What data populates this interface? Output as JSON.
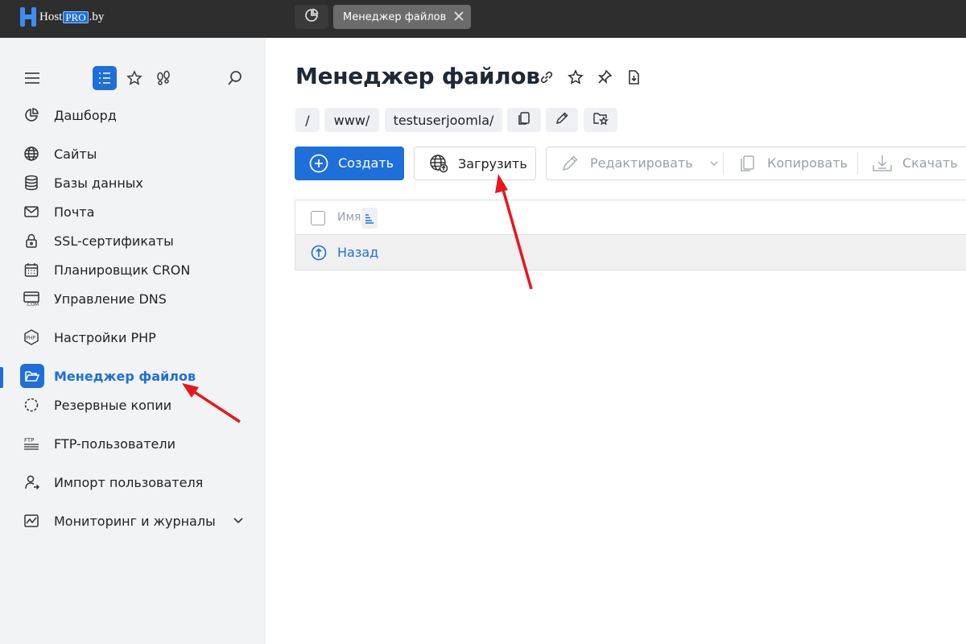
{
  "brand": {
    "host": "Host",
    "pro": "PRO",
    "suffix": ".by"
  },
  "tabs": {
    "active_label": "Менеджер файлов"
  },
  "sidebar": {
    "items": [
      {
        "label": "Дашборд",
        "icon": "dashboard-icon"
      },
      {
        "label": "Сайты",
        "icon": "globe-icon"
      },
      {
        "label": "Базы данных",
        "icon": "database-icon"
      },
      {
        "label": "Почта",
        "icon": "mail-icon"
      },
      {
        "label": "SSL-сертификаты",
        "icon": "lock-icon"
      },
      {
        "label": "Планировщик CRON",
        "icon": "calendar-icon"
      },
      {
        "label": "Управление DNS",
        "icon": "dns-icon"
      },
      {
        "label": "Настройки PHP",
        "icon": "php-icon"
      },
      {
        "label": "Менеджер файлов",
        "icon": "folder-icon",
        "active": true
      },
      {
        "label": "Резервные копии",
        "icon": "backup-icon"
      },
      {
        "label": "FTP-пользователи",
        "icon": "ftp-icon"
      },
      {
        "label": "Импорт пользователя",
        "icon": "user-import-icon"
      },
      {
        "label": "Мониторинг и журналы",
        "icon": "monitoring-icon"
      }
    ]
  },
  "main": {
    "title": "Менеджер файлов",
    "breadcrumbs": [
      "/",
      "www/",
      "testuserjoomla/"
    ],
    "toolbar": {
      "create": "Создать",
      "upload": "Загрузить",
      "edit": "Редактировать",
      "copy": "Копировать",
      "download": "Скачать"
    },
    "table": {
      "col_name": "Имя",
      "back": "Назад"
    }
  },
  "colors": {
    "accent": "#1e6fd9",
    "annotation": "#e8161b"
  }
}
